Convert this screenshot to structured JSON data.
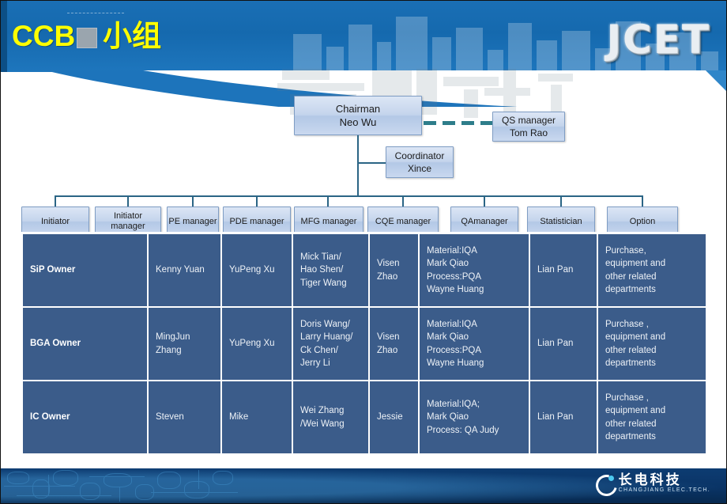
{
  "header": {
    "title_main": "CCB",
    "title_sub": "小组",
    "logo": "JCET"
  },
  "org_chart": {
    "chairman": {
      "role": "Chairman",
      "name": "Neo Wu"
    },
    "qs_manager": {
      "role": "QS manager",
      "name": "Tom Rao"
    },
    "coordinator": {
      "role": "Coordinator",
      "name": "Xince"
    },
    "departments": [
      {
        "label": "Initiator"
      },
      {
        "label": "Initiator manager"
      },
      {
        "label": "PE manager"
      },
      {
        "label": "PDE manager"
      },
      {
        "label": "MFG manager"
      },
      {
        "label": "CQE manager"
      },
      {
        "label": "QAmanager"
      },
      {
        "label": "Statistician"
      },
      {
        "label": "Option"
      }
    ]
  },
  "table": {
    "rows": [
      {
        "owner": "SiP Owner",
        "initiator_manager": "Kenny Yuan",
        "pe_manager": "YuPeng Xu",
        "pde_mfg": [
          "Mick Tian/",
          "Hao Shen/",
          "Tiger Wang"
        ],
        "cqe": [
          "Visen",
          "Zhao"
        ],
        "qa": [
          "Material:IQA",
          "Mark Qiao",
          "Process:PQA",
          "Wayne Huang"
        ],
        "statistician": "Lian Pan",
        "option": [
          "Purchase,",
          "equipment and",
          "other related",
          "departments"
        ]
      },
      {
        "owner": "BGA Owner",
        "initiator_manager": [
          "MingJun",
          "Zhang"
        ],
        "pe_manager": "YuPeng Xu",
        "pde_mfg": [
          "Doris Wang/",
          "Larry Huang/",
          "Ck Chen/",
          "Jerry Li"
        ],
        "cqe": [
          "Visen",
          "Zhao"
        ],
        "qa": [
          "Material:IQA",
          "Mark Qiao",
          "Process:PQA",
          "Wayne Huang"
        ],
        "statistician": "Lian Pan",
        "option": [
          "Purchase ,",
          "equipment and",
          "other related",
          "departments"
        ]
      },
      {
        "owner": "IC  Owner",
        "initiator_manager": "Steven",
        "pe_manager": "Mike",
        "pde_mfg": [
          "Wei Zhang",
          "/Wei Wang"
        ],
        "cqe": "Jessie",
        "qa": [
          "Material:IQA;",
          "Mark Qiao",
          "Process: QA Judy"
        ],
        "statistician": "Lian Pan",
        "option": [
          "Purchase ,",
          "equipment and",
          "other related",
          "departments"
        ]
      }
    ]
  },
  "footer": {
    "company_cn": "长电科技",
    "company_en": "CHANGJIANG ELEC.TECH."
  },
  "colors": {
    "header_blue": "#1569ae",
    "title_yellow": "#ffff00",
    "table_cell": "#3b5c8a",
    "connector": "#2b6585",
    "dashed_connector": "#2e7d8a",
    "footer_blue": "#0a3466"
  }
}
